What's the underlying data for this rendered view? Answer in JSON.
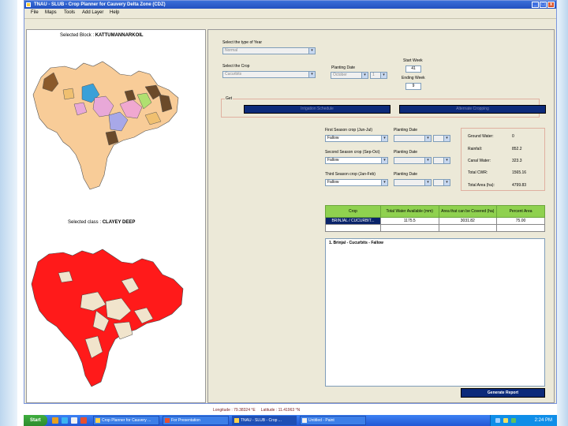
{
  "window": {
    "title": "TNAU - SLUB - Crop Planner for Cauvery Delta Zone (CDZ)",
    "buttons": [
      "_",
      "□",
      "x"
    ]
  },
  "menu": [
    "File",
    "Maps",
    "Tools",
    "Add Layer",
    "Help"
  ],
  "left": {
    "selected_block_label": "Selected Block :",
    "selected_block_value": "KATTUMANNARKOIL",
    "selected_class_label": "Selected class :",
    "selected_class_value": "CLAYEY DEEP"
  },
  "form": {
    "year_type_label": "Select the type of Year",
    "year_type_value": "Normal",
    "crop_label": "Select the Crop",
    "crop_value": "Cucurbits",
    "planting_date_label": "Planting Date",
    "planting_month": "October",
    "planting_day": "1",
    "start_week_label": "Start Week",
    "start_week_value": "41",
    "ending_week_label": "Ending Week",
    "ending_week_value": "9",
    "get_label": "Get",
    "btn_irrigation": "Irrigation Schedule",
    "btn_cropping": "Alternate Cropping",
    "first_season_label": "First Season crop (Jun-Jul)",
    "second_season_label": "Second Season crop (Sep-Oct)",
    "third_season_label": "Third Season crop (Jan-Feb)",
    "season_value": "Fallow",
    "season_planting_label": "Planting Date"
  },
  "stats": {
    "items": [
      {
        "label": "Ground Water:",
        "value": "0"
      },
      {
        "label": "Rainfall:",
        "value": "852.2"
      },
      {
        "label": "Canal Water:",
        "value": "323.3"
      },
      {
        "label": "Total CWR:",
        "value": "1565.16"
      },
      {
        "label": "Total Area (ha):",
        "value": "4799.83"
      }
    ]
  },
  "table": {
    "headers": [
      "Crop",
      "Total Water Available (mm)",
      "Area that can be Covered (ha)",
      "Percent Area"
    ],
    "row": [
      "BRINJAL / CUCURBIT...",
      "1175.5",
      "3031.82",
      "75.00"
    ]
  },
  "result_text": "1. Brinjal - Cucurbits - Fallow",
  "generate_report": "Generate Report",
  "coords": {
    "longitude_label": "Longitude :",
    "longitude_value": "79.38324 °E",
    "latitude_label": "Latitude :",
    "latitude_value": "11.41963 °N"
  },
  "taskbar": {
    "start": "Start",
    "tasks": [
      "Crop Planner for Cauvery ...",
      "For Presentation",
      "TNAU - SLUB - Crop ...",
      "Untitled - Paint"
    ],
    "clock": "2:24 PM"
  },
  "colors": {
    "titlebar": "#2350c0",
    "navy_button": "#0c2a7a",
    "table_header": "#8fd14f",
    "map_red": "#ff1a1a",
    "map_peach": "#f8cc98"
  }
}
